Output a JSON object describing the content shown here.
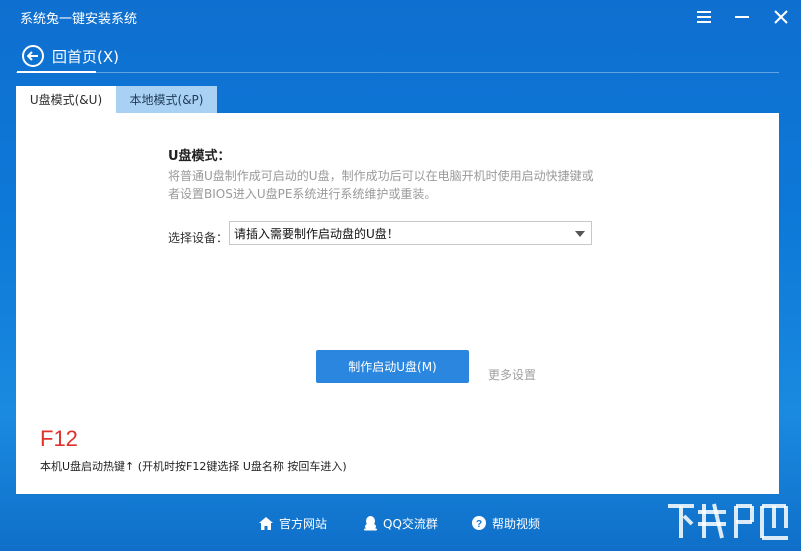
{
  "window": {
    "title": "系统兔一键安装系统",
    "controls": {
      "menu_icon": "hamburger-icon",
      "minimize_icon": "minimize-icon",
      "close_icon": "close-icon"
    }
  },
  "nav": {
    "back_label": "回首页(X)",
    "back_icon": "back-arrow-icon"
  },
  "tabs": [
    {
      "label": "U盘模式(&U)",
      "active": true
    },
    {
      "label": "本地模式(&P)",
      "active": false
    }
  ],
  "usb_mode": {
    "title": "U盘模式：",
    "description": "将普通U盘制作成可启动的U盘，制作成功后可以在电脑开机时使用启动快捷键或者设置BIOS进入U盘PE系统进行系统维护或重装。",
    "device_label": "选择设备：",
    "device_value": "请插入需要制作启动盘的U盘！",
    "make_button": "制作启动U盘(M)",
    "more_settings": "更多设置"
  },
  "hotkey": {
    "key": "F12",
    "hint": "本机U盘启动热键↑ (开机时按F12键选择 U盘名称 按回车进入)"
  },
  "footer": {
    "links": [
      {
        "label": "官方网站",
        "icon": "home-icon"
      },
      {
        "label": "QQ交流群",
        "icon": "qq-penguin-icon"
      },
      {
        "label": "帮助视频",
        "icon": "help-circle-icon"
      }
    ]
  },
  "colors": {
    "accent_blue": "#2a86df",
    "background_blue": "#0d79d8",
    "hotkey_red": "#e0322b",
    "tab_inactive": "#a9d1f3"
  },
  "watermark": {
    "icon": "download-site-logo-icon"
  }
}
